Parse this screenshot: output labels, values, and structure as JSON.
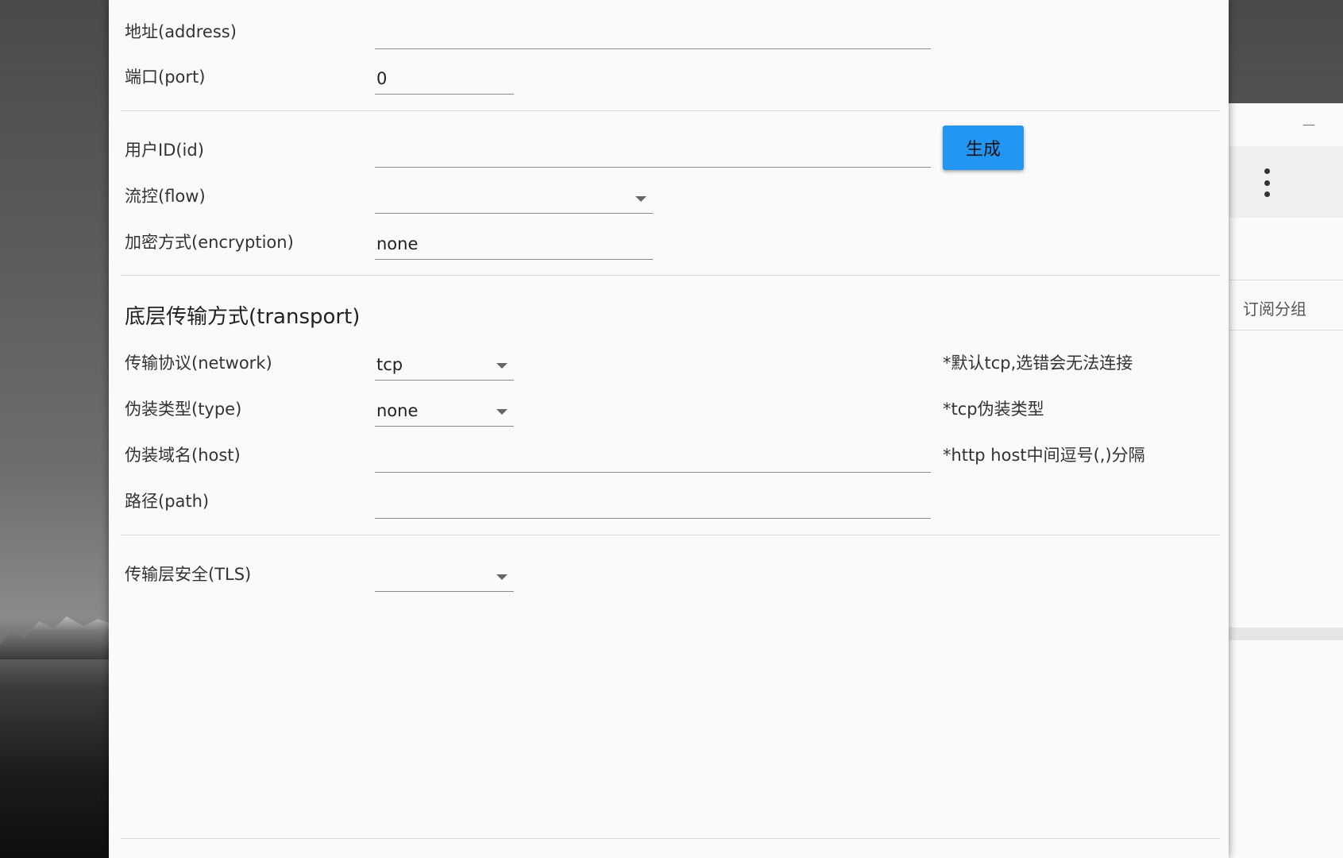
{
  "background_window": {
    "minimize_glyph": "—",
    "tab_label": "订阅分组"
  },
  "dialog": {
    "fields": {
      "address": {
        "label": "地址(address)",
        "value": ""
      },
      "port": {
        "label": "端口(port)",
        "value": "0"
      },
      "id": {
        "label": "用户ID(id)",
        "value": "",
        "generate_label": "生成"
      },
      "flow": {
        "label": "流控(flow)",
        "value": ""
      },
      "encryption": {
        "label": "加密方式(encryption)",
        "value": "none"
      }
    },
    "transport": {
      "title": "底层传输方式(transport)",
      "network": {
        "label": "传输协议(network)",
        "value": "tcp",
        "hint": "*默认tcp,选错会无法连接"
      },
      "type": {
        "label": "伪装类型(type)",
        "value": "none",
        "hint": "*tcp伪装类型"
      },
      "host": {
        "label": "伪装域名(host)",
        "value": "",
        "hint": "*http host中间逗号(,)分隔"
      },
      "path": {
        "label": "路径(path)",
        "value": ""
      }
    },
    "tls": {
      "label": "传输层安全(TLS)",
      "value": ""
    }
  },
  "colors": {
    "accent": "#2196f3",
    "dialog_bg": "#fafafa",
    "text": "#333333",
    "underline": "#8a8a8a"
  }
}
